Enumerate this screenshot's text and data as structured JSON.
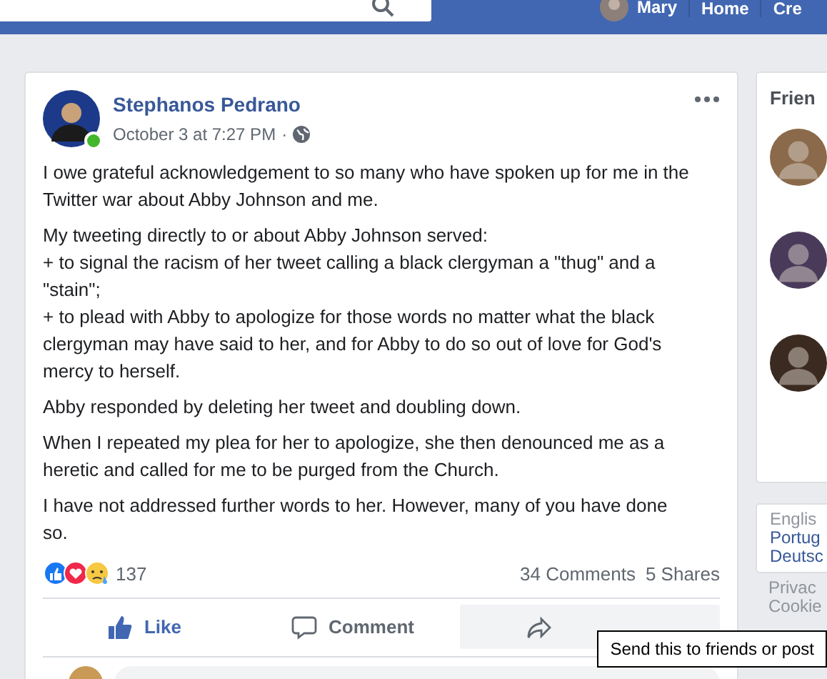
{
  "top_bar": {
    "user": "Mary",
    "links": [
      "Home",
      "Cre"
    ]
  },
  "post": {
    "author": "Stephanos Pedrano",
    "online": true,
    "time": "October 3 at 7:27 PM",
    "separator": "·",
    "paragraphs": [
      [
        "I owe grateful acknowledgement to so many who have spoken up for me in the Twitter war about Abby Johnson and me."
      ],
      [
        "My tweeting directly to or about Abby Johnson served:",
        "+ to signal the racism of her tweet calling a black clergyman a \"thug\" and a \"stain\";",
        "+ to plead with Abby to apologize for those words no matter what the black clergyman may have said to her, and for Abby to do so out of love for God's mercy to herself."
      ],
      [
        "Abby responded by deleting her tweet and doubling down."
      ],
      [
        "When I repeated my plea for her to apologize, she then denounced me as a heretic and called for me to be purged from the Church."
      ],
      [
        "I have not addressed further words to her. However, many of you have done so."
      ]
    ],
    "reaction_count": "137",
    "comments": "34 Comments",
    "shares": "5 Shares",
    "actions": [
      {
        "kind": "like",
        "label": "Like",
        "selected": true,
        "hovered": false
      },
      {
        "kind": "comment",
        "label": "Comment",
        "selected": false,
        "hovered": false
      },
      {
        "kind": "share",
        "hovered": true
      }
    ]
  },
  "sidebar": {
    "friends_title": "Frien",
    "friends": [
      {
        "color": "#8a6a4a"
      },
      {
        "color": "#4a3a5a"
      },
      {
        "color": "#3a2a20"
      }
    ],
    "languages": [
      "Englis",
      "Portug",
      "Deutsc"
    ],
    "footer": [
      "Privac",
      "Cookie"
    ]
  },
  "tooltip": "Send this to friends or post"
}
